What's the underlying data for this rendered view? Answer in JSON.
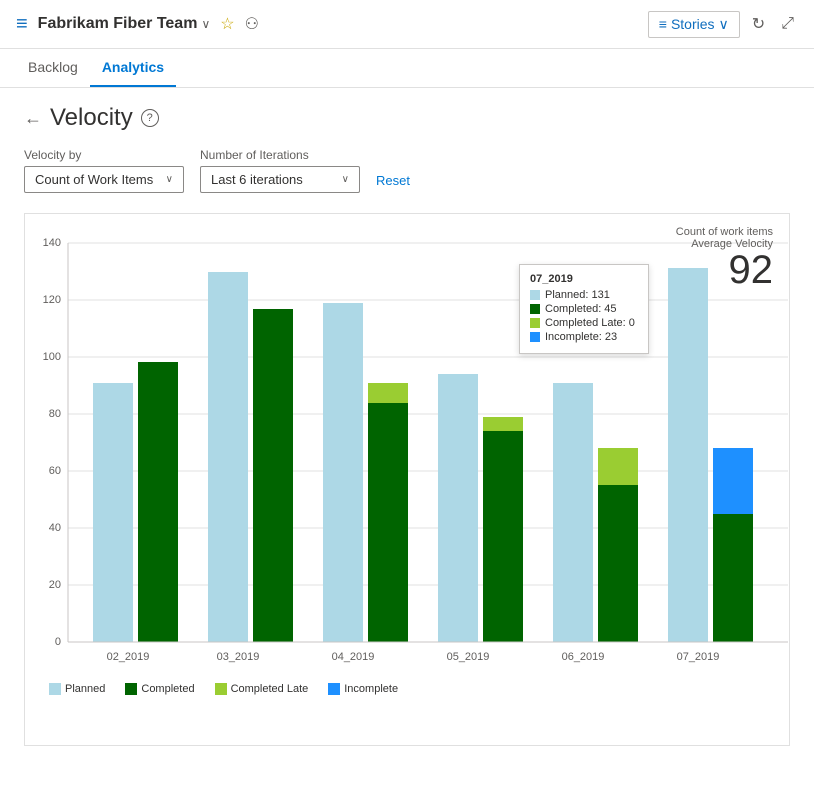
{
  "header": {
    "icon": "≡",
    "team_name": "Fabrikam Fiber Team",
    "chevron": "∨",
    "star": "☆",
    "people": "⚇",
    "stories_label": "Stories",
    "stories_chevron": "∨",
    "refresh_icon": "↻",
    "expand_icon": "⤢"
  },
  "nav": {
    "tabs": [
      {
        "label": "Backlog",
        "active": false
      },
      {
        "label": "Analytics",
        "active": true
      }
    ]
  },
  "page": {
    "back_icon": "←",
    "title": "Velocity",
    "help_icon": "?"
  },
  "filters": {
    "velocity_by_label": "Velocity by",
    "velocity_by_value": "Count of Work Items",
    "iterations_label": "Number of Iterations",
    "iterations_value": "Last 6 iterations",
    "reset_label": "Reset"
  },
  "velocity_summary": {
    "line1": "Count of work items",
    "line2": "Average Velocity",
    "number": "92"
  },
  "tooltip": {
    "title": "07_2019",
    "rows": [
      {
        "color": "#add8e6",
        "label": "Planned: 131"
      },
      {
        "color": "#006400",
        "label": "Completed: 45"
      },
      {
        "color": "#9acd32",
        "label": "Completed Late: 0"
      },
      {
        "color": "#1e90ff",
        "label": "Incomplete: 23"
      }
    ]
  },
  "chart": {
    "bars": [
      {
        "label": "02_2019",
        "planned": 91,
        "completed": 98,
        "completed_late": 0,
        "incomplete": 0
      },
      {
        "label": "03_2019",
        "planned": 130,
        "completed": 117,
        "completed_late": 5,
        "incomplete": 0
      },
      {
        "label": "04_2019",
        "planned": 119,
        "completed": 84,
        "completed_late": 7,
        "incomplete": 0
      },
      {
        "label": "05_2019",
        "planned": 94,
        "completed": 74,
        "completed_late": 5,
        "incomplete": 0
      },
      {
        "label": "06_2019",
        "planned": 91,
        "completed": 55,
        "completed_late": 13,
        "incomplete": 0
      },
      {
        "label": "07_2019",
        "planned": 131,
        "completed": 45,
        "completed_late": 0,
        "incomplete": 23
      }
    ],
    "y_labels": [
      0,
      20,
      40,
      60,
      80,
      100,
      120,
      140
    ],
    "colors": {
      "planned": "#add8e6",
      "completed": "#006400",
      "completed_late": "#9acd32",
      "incomplete": "#1e90ff"
    }
  },
  "legend": {
    "items": [
      {
        "label": "Planned",
        "color": "#add8e6"
      },
      {
        "label": "Completed",
        "color": "#006400"
      },
      {
        "label": "Completed Late",
        "color": "#9acd32"
      },
      {
        "label": "Incomplete",
        "color": "#1e90ff"
      }
    ]
  }
}
